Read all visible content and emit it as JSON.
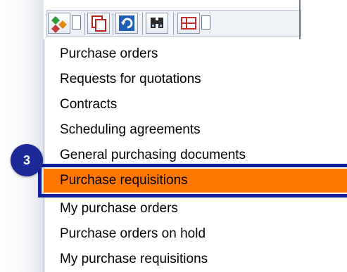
{
  "toolbar": {
    "buttons": [
      {
        "icon": "tree-structure-icon"
      },
      {
        "icon": "copy-icon"
      },
      {
        "icon": "refresh-icon"
      },
      {
        "icon": "find-icon"
      },
      {
        "icon": "layout-grid-icon"
      }
    ]
  },
  "menu": {
    "items": [
      {
        "label": "Purchase orders"
      },
      {
        "label": "Requests for quotations"
      },
      {
        "label": "Contracts"
      },
      {
        "label": "Scheduling agreements"
      },
      {
        "label": "General purchasing documents"
      },
      {
        "label": "Purchase requisitions"
      },
      {
        "label": "My purchase orders"
      },
      {
        "label": "Purchase orders on hold"
      },
      {
        "label": "My purchase requisitions"
      }
    ],
    "selected_index": 5
  },
  "callout": {
    "step": "3"
  },
  "colors": {
    "selection": "#ff7700",
    "callout": "#1b2a96",
    "highlight_border": "#0f1e9a"
  }
}
